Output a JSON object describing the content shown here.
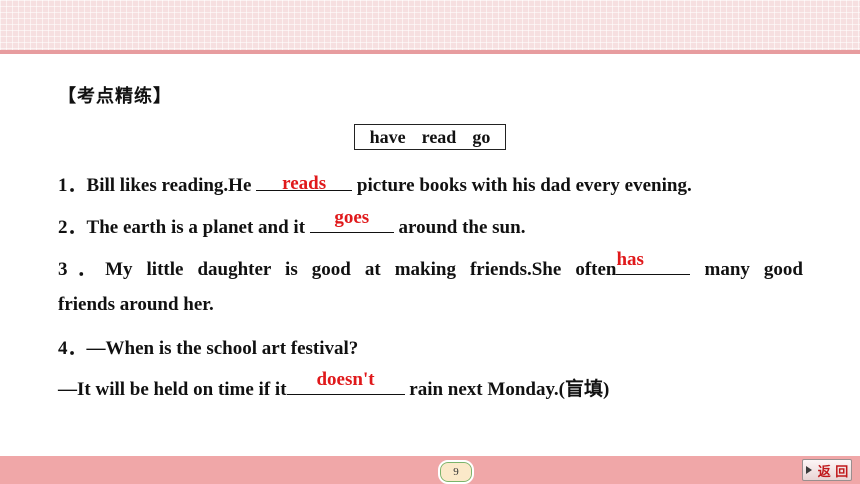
{
  "heading": "【考点精练】",
  "word_box": [
    "have",
    "read",
    "go"
  ],
  "questions": [
    {
      "number": "1．",
      "pre": "Bill likes reading.He ",
      "answer": "reads",
      "post": " picture books with his dad every evening."
    },
    {
      "number": "2．",
      "pre": "The earth is a planet and it ",
      "answer": "goes",
      "post": " around the sun."
    },
    {
      "number": "3．",
      "pre": "My little daughter is good at making friends.She often",
      "answer": "has",
      "post": " many good",
      "continuation": "friends around her."
    },
    {
      "number": "4．",
      "line1": "—When is the school art festival?",
      "pre": "—It will be held on time if it",
      "answer": "doesn't",
      "post": " rain next Monday.(盲填)"
    }
  ],
  "footer": {
    "page_number": "9",
    "back_label": "返 回"
  },
  "colors": {
    "answer": "#e0191b",
    "top_band": "#f6dfe0",
    "bottom_bar": "#f0a7a8"
  }
}
